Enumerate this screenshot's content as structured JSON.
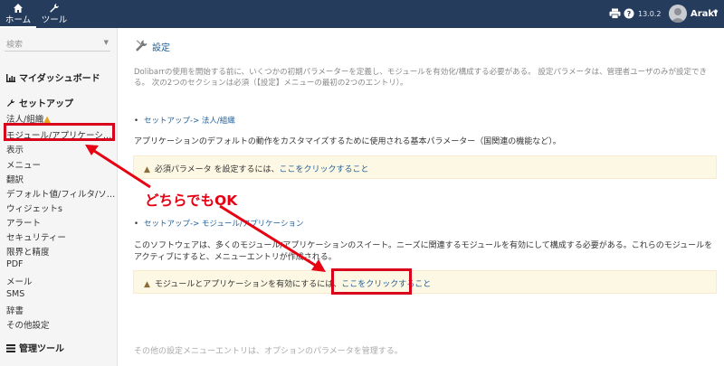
{
  "topbar": {
    "home_label": "ホーム",
    "tools_label": "ツール",
    "version": "13.0.2",
    "user_name": "Araki"
  },
  "sidebar": {
    "search_placeholder": "検索",
    "dashboard_label": "マイダッシュボード",
    "setup_label": "セットアップ",
    "items": [
      "法人/組織",
      "モジュール/アプリケーシ…",
      "表示",
      "メニュー",
      "翻訳",
      "デフォルト値/フィルタ/ソ…",
      "ウィジェットs",
      "アラート",
      "セキュリティー",
      "限界と精度",
      "PDF",
      "メール",
      "SMS",
      "辞書",
      "その他設定"
    ],
    "admin_tools_label": "管理ツール"
  },
  "main": {
    "title": "設定",
    "intro": "Dolibarrの使用を開始する前に、いくつかの初期パラメーターを定義し、モジュールを有効化/構成する必要がある。 設定パラメータは、管理者ユーザのみが設定できる。 次の2つのセクションは必須（【設定】メニューの最初の2つのエントリ）。",
    "section1_link": "セットアップ-> 法人/組織",
    "section1_desc": "アプリケーションのデフォルトの動作をカスタマイズするために使用される基本パラメーター（国関連の機能など）。",
    "warn1_text": "必須パラメータ を設定するには、",
    "warn1_link": "ここをクリックすること",
    "section2_link": "セットアップ-> モジュール/アプリケーション",
    "section2_desc": "このソフトウェアは、多くのモジュール/アプリケーションのスイート。ニーズに関連するモジュールを有効にして構成する必要がある。これらのモジュールをアクティブにすると、メニューエントリが作成される。",
    "warn2_text": "モジュールとアプリケーションを有効にするには、",
    "warn2_link": "ここをクリックすること",
    "footer": "その他の設定メニューエントリは、オプションのパラメータを管理する。"
  },
  "annotation": {
    "text": "どちらでもOK",
    "color": "#e60012"
  },
  "colors": {
    "topbar": "#263c5c",
    "link": "#1f5e99",
    "warning_bg": "#fcf8e3",
    "warning_icon": "#e8a317"
  }
}
